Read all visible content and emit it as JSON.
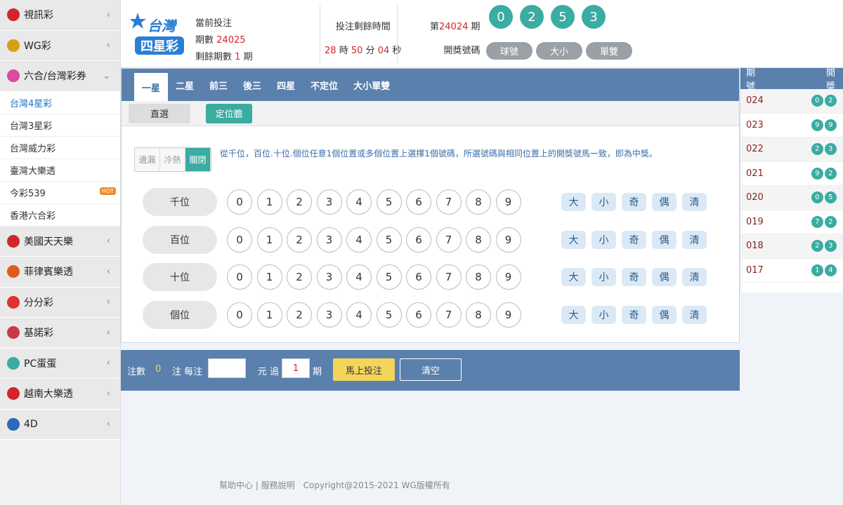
{
  "sidebar": {
    "items": [
      {
        "label": "視訊彩",
        "icon": "play-icon",
        "color": "#d0262b"
      },
      {
        "label": "WG彩",
        "icon": "w-coin-icon",
        "color": "#d4a017"
      },
      {
        "label": "六合/台灣彩券",
        "icon": "tree-icon",
        "color": "#d94aa0",
        "expanded": true
      }
    ],
    "subitems": [
      "台灣4星彩",
      "台灣3星彩",
      "台灣威力彩",
      "臺灣大樂透",
      "今彩539",
      "香港六合彩"
    ],
    "hot": "HOT",
    "items2": [
      {
        "label": "美國天天樂",
        "icon": "star-icon",
        "color": "#d0262b"
      },
      {
        "label": "菲律賓樂透",
        "icon": "pinwheel-icon",
        "color": "#e05a1a"
      },
      {
        "label": "分分彩",
        "icon": "lightning-icon",
        "color": "#e03030"
      },
      {
        "label": "基諾彩",
        "icon": "k-icon",
        "color": "#c83a4a"
      },
      {
        "label": "PC蛋蛋",
        "icon": "28-icon",
        "color": "#3aaca2"
      },
      {
        "label": "越南大樂透",
        "icon": "star-icon",
        "color": "#d0262b"
      },
      {
        "label": "4D",
        "icon": "globe-icon",
        "color": "#2a6ab8"
      }
    ]
  },
  "header": {
    "logo_line1": "台灣",
    "logo_line2": "四星彩",
    "current_label": "當前投注",
    "period_label": "期數",
    "period": "24025",
    "remain_label": "剩餘期數",
    "remain": "1",
    "remain_unit": "期",
    "timer_label": "投注剩餘時間",
    "h": "28",
    "m": "50",
    "s": "04",
    "h_u": "時",
    "m_u": "分",
    "s_u": "秒",
    "issue_pre": "第",
    "issue": "24024",
    "issue_post": "期",
    "draw_label": "開獎號碼",
    "balls": [
      "0",
      "2",
      "5",
      "3"
    ],
    "btns": [
      "球號",
      "大小",
      "單雙"
    ]
  },
  "tabs": [
    "一星",
    "二星",
    "前三",
    "後三",
    "四星",
    "不定位",
    "大小單雙"
  ],
  "subtabs": [
    "直選",
    "定位膽"
  ],
  "toggle": [
    "遺漏",
    "冷熱",
    "關閉"
  ],
  "desc": "從千位，百位.十位.個位任意1個位置或多個位置上選擇1個號碼，所選號碼與相同位置上的開獎號馬一致，即為中獎。",
  "rows": [
    "千位",
    "百位",
    "十位",
    "個位"
  ],
  "nums": [
    "0",
    "1",
    "2",
    "3",
    "4",
    "5",
    "6",
    "7",
    "8",
    "9"
  ],
  "quick": [
    "大",
    "小",
    "奇",
    "偶",
    "清"
  ],
  "bar": {
    "count_label": "注數",
    "count": "0",
    "per": "注 每注",
    "yuan": "元 追",
    "chase": "1",
    "qi": "期",
    "bet": "馬上投注",
    "clear": "清空"
  },
  "history": {
    "h1": "期號",
    "h2": "開獎",
    "rows": [
      {
        "p": "024",
        "b": [
          "0",
          "2"
        ]
      },
      {
        "p": "023",
        "b": [
          "9",
          "9"
        ]
      },
      {
        "p": "022",
        "b": [
          "2",
          "3"
        ]
      },
      {
        "p": "021",
        "b": [
          "9",
          "2"
        ]
      },
      {
        "p": "020",
        "b": [
          "0",
          "5"
        ]
      },
      {
        "p": "019",
        "b": [
          "7",
          "2"
        ]
      },
      {
        "p": "018",
        "b": [
          "2",
          "3"
        ]
      },
      {
        "p": "017",
        "b": [
          "1",
          "4"
        ]
      }
    ]
  },
  "footer": "幫助中心 | 服務說明　Copyright@2015-2021 WG版權所有"
}
